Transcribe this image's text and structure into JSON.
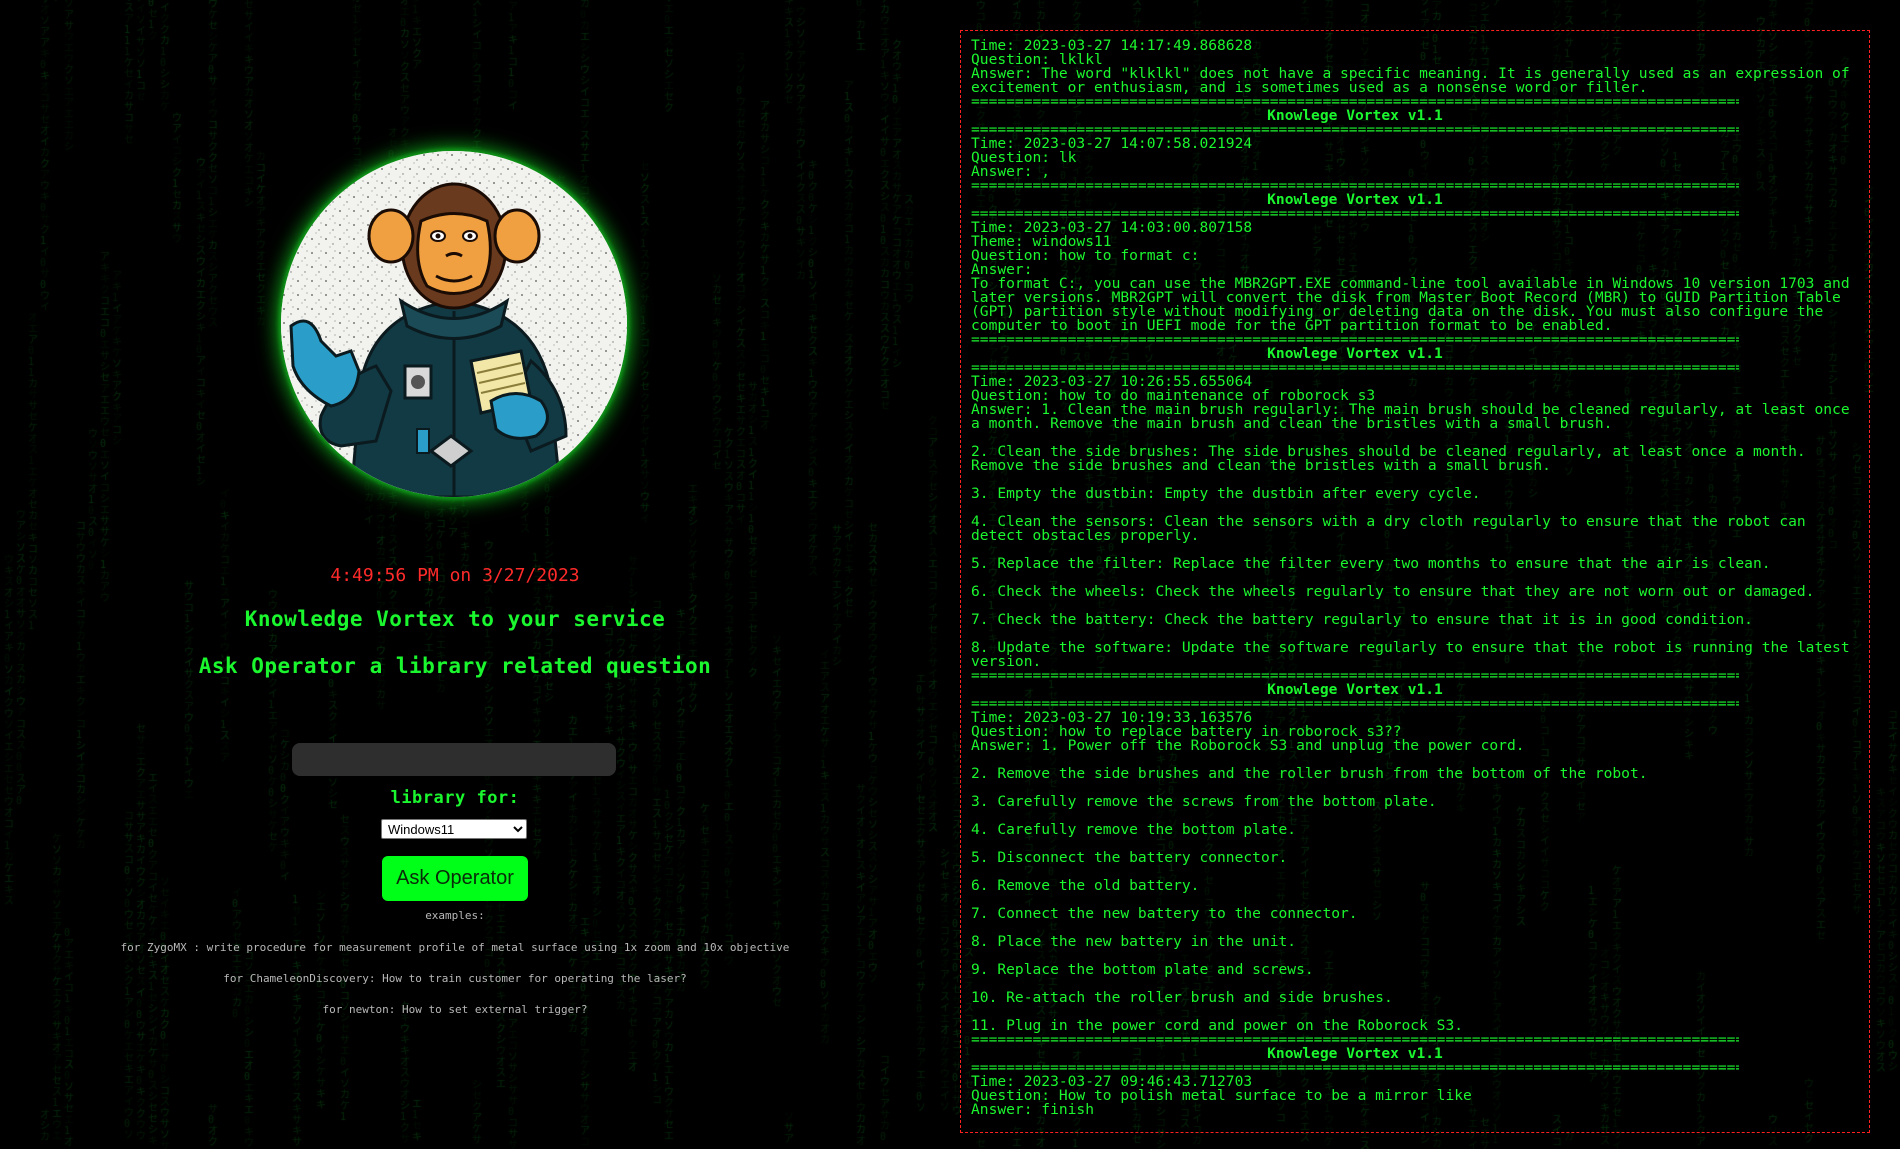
{
  "clock": "4:49:56 PM on 3/27/2023",
  "headings": {
    "service": "Knowledge Vortex to your service",
    "ask": "Ask Operator a library related question"
  },
  "question_input": {
    "value": "",
    "placeholder": ""
  },
  "library_label": "library for:",
  "library_select": {
    "selected": "Windows11",
    "options": [
      "Windows11"
    ]
  },
  "ask_button": "Ask Operator",
  "examples": {
    "label": "examples:",
    "items": [
      "for ZygoMX : write procedure for measurement profile of metal surface using 1x zoom and 10x objective",
      "for ChameleonDiscovery: How to train customer for operating the laser?",
      "for newton: How to set external trigger?"
    ]
  },
  "avatar_icon": "astronaut-chimp-icon",
  "colors": {
    "accent_green": "#1bf72e",
    "clock_red": "#ff2a2a",
    "button_green": "#00ff18",
    "log_border": "#ff2020"
  },
  "log": {
    "separator": "==========================================================================================",
    "banner": "Knowlege Vortex v1.1",
    "entries": [
      {
        "lines": [
          "Time: 2023-03-27 14:17:49.868628",
          "Question: lklkl",
          "Answer: The word \"klklkl\" does not have a specific meaning. It is generally used as an expression of excitement or enthusiasm, and is sometimes used as a nonsense word or filler."
        ]
      },
      {
        "lines": [
          "Time: 2023-03-27 14:07:58.021924",
          "Question: lk",
          "Answer: ,"
        ]
      },
      {
        "lines": [
          "Time: 2023-03-27 14:03:00.807158",
          "Theme: windows11",
          "Question: how to format c:",
          "Answer:",
          "To format C:, you can use the MBR2GPT.EXE command-line tool available in Windows 10 version 1703 and later versions. MBR2GPT will convert the disk from Master Boot Record (MBR) to GUID Partition Table (GPT) partition style without modifying or deleting data on the disk. You must also configure the computer to boot in UEFI mode for the GPT partition format to be enabled."
        ]
      },
      {
        "lines": [
          "Time: 2023-03-27 10:26:55.655064",
          "Question: how to do maintenance of roborock s3",
          "Answer: 1. Clean the main brush regularly: The main brush should be cleaned regularly, at least once a month. Remove the main brush and clean the bristles with a small brush.",
          "",
          "2. Clean the side brushes: The side brushes should be cleaned regularly, at least once a month. Remove the side brushes and clean the bristles with a small brush.",
          "",
          "3. Empty the dustbin: Empty the dustbin after every cycle.",
          "",
          "4. Clean the sensors: Clean the sensors with a dry cloth regularly to ensure that the robot can detect obstacles properly.",
          "",
          "5. Replace the filter: Replace the filter every two months to ensure that the air is clean.",
          "",
          "6. Check the wheels: Check the wheels regularly to ensure that they are not worn out or damaged.",
          "",
          "7. Check the battery: Check the battery regularly to ensure that it is in good condition.",
          "",
          "8. Update the software: Update the software regularly to ensure that the robot is running the latest version."
        ]
      },
      {
        "lines": [
          "Time: 2023-03-27 10:19:33.163576",
          "Question: how to replace battery in roborock s3??",
          "Answer: 1. Power off the Roborock S3 and unplug the power cord.",
          "",
          "2. Remove the side brushes and the roller brush from the bottom of the robot.",
          "",
          "3. Carefully remove the screws from the bottom plate.",
          "",
          "4. Carefully remove the bottom plate.",
          "",
          "5. Disconnect the battery connector.",
          "",
          "6. Remove the old battery.",
          "",
          "7. Connect the new battery to the connector.",
          "",
          "8. Place the new battery in the unit.",
          "",
          "9. Replace the bottom plate and screws.",
          "",
          "10. Re-attach the roller brush and side brushes.",
          "",
          "11. Plug in the power cord and power on the Roborock S3."
        ]
      },
      {
        "lines": [
          "Time: 2023-03-27 09:46:43.712703",
          "Question: How to polish metal surface to be a mirror like",
          "Answer: finish"
        ]
      }
    ]
  }
}
